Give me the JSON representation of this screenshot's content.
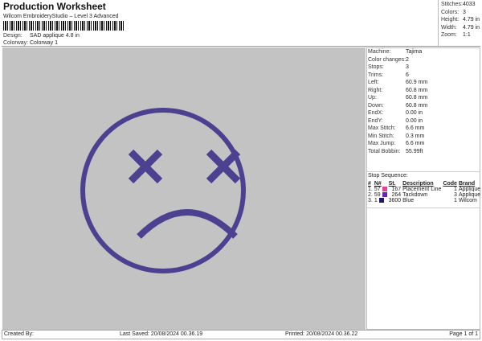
{
  "header": {
    "title": "Production Worksheet",
    "subtitle": "Wilcom EmbroideryStudio – Level 3 Advanced",
    "design_label": "Design:",
    "design": "SAD applique 4.8 in",
    "colorway_label": "Colorway:",
    "colorway": "Colorway 1"
  },
  "stats": [
    {
      "k": "Stitches:",
      "v": "4033"
    },
    {
      "k": "Colors:",
      "v": "3"
    },
    {
      "k": "Height:",
      "v": "4.79 in"
    },
    {
      "k": "Width:",
      "v": "4.79 in"
    },
    {
      "k": "Zoom:",
      "v": "1:1"
    }
  ],
  "details": [
    {
      "k": "Machine:",
      "v": "Tajima"
    },
    {
      "k": "Color changes:",
      "v": "2"
    },
    {
      "k": "Stops:",
      "v": "3"
    },
    {
      "k": "Trims:",
      "v": "6"
    },
    {
      "k": "Left:",
      "v": "60.9 mm"
    },
    {
      "k": "Right:",
      "v": "60.8 mm"
    },
    {
      "k": "Up:",
      "v": "60.8 mm"
    },
    {
      "k": "Down:",
      "v": "60.8 mm"
    },
    {
      "k": "EndX:",
      "v": "0.00 in"
    },
    {
      "k": "EndY:",
      "v": "0.00 in"
    },
    {
      "k": "Max Stitch:",
      "v": "6.6 mm"
    },
    {
      "k": "Min Stitch:",
      "v": "0.3 mm"
    },
    {
      "k": "Max Jump:",
      "v": "6.6 mm"
    },
    {
      "k": "Total Bobbin:",
      "v": "55.99ft"
    }
  ],
  "stop_sequence": {
    "title": "Stop Sequence:",
    "headers": [
      "#",
      "N#",
      "St.",
      "Description",
      "Code",
      "Brand"
    ],
    "rows": [
      {
        "i": "1.",
        "n": "57",
        "color": "#e8409a",
        "st": "167",
        "desc": "Placement Line",
        "code": "1",
        "brand": "Applique"
      },
      {
        "i": "2.",
        "n": "59",
        "color": "#6a22b8",
        "st": "264",
        "desc": "Tackdown",
        "code": "3",
        "brand": "Applique"
      },
      {
        "i": "3.",
        "n": "1",
        "color": "#1e1a6a",
        "st": "3600",
        "desc": "Blue",
        "code": "1",
        "brand": "Wilcom"
      }
    ]
  },
  "design_color": "#4b4190",
  "footer": {
    "created": "Created By:",
    "saved": "Last Saved: 20/08/2024 00.36.19",
    "printed": "Printed: 20/08/2024 00.36.22",
    "page": "Page 1 of 1"
  }
}
